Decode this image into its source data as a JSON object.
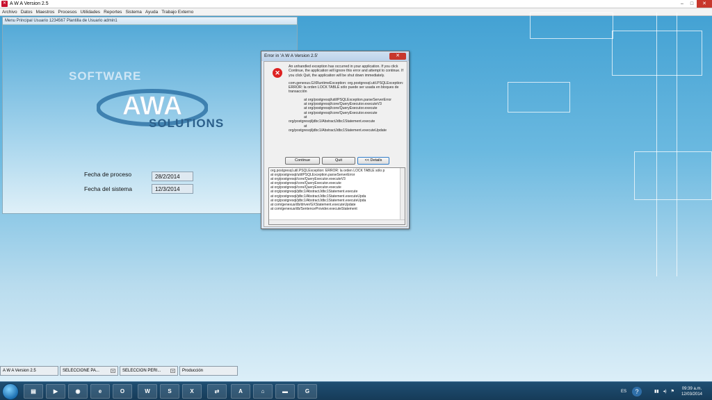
{
  "window": {
    "title": "A W A Version 2.5",
    "min": "–",
    "max": "□",
    "close": "✕"
  },
  "menu": [
    "Archivo",
    "Datos",
    "Maestros",
    "Procesos",
    "Utilidades",
    "Reportes",
    "Sistema",
    "Ayuda",
    "Trabajo Externo"
  ],
  "child_window": {
    "title": "Menu Principal  Usuario 1234567 Plantilla de Usuario admin1",
    "logo_software": "SOFTWARE",
    "logo_awa": "AWA",
    "logo_solutions": "SOLUTIONS",
    "fecha_proceso_label": "Fecha de proceso",
    "fecha_proceso_value": "28/2/2014",
    "fecha_sistema_label": "Fecha del sistema",
    "fecha_sistema_value": "12/3/2014"
  },
  "error_dialog": {
    "title": "Error in 'A W A Version 2.5'",
    "close": "✕",
    "icon": "error-icon",
    "message": "An unhandled exception has occurred in your application. If you click Continue, the application will ignore this error and attempt to continue. If you click Quit, the application will be shut down immediately.",
    "exception": "com.genexus.GXRuntimeException: org.postgresql.util.PSQLException: ERROR: la orden LOCK TABLE sólo puede ser usada en bloques de transacción",
    "stack": [
      "at org/postgresql/util/PSQLException.parseServerError",
      "at org/postgresql/core/QueryExecutor.executeV3",
      "at org/postgresql/core/QueryExecutor.execute",
      "at org/postgresql/core/QueryExecutor.execute",
      "at",
      "org/postgresql/jdbc1/AbstractJdbc1Statement.execute",
      "at",
      "org/postgresql/jdbc1/AbstractJdbc1Statement.executeUpdate"
    ],
    "btn_continue": "Continue",
    "btn_quit": "Quit",
    "btn_details": "<< Details",
    "details": [
      "org.postgresql.util.PSQLException: ERROR: la orden LOCK TABLE sólo p",
      "       at org/postgresql/util/PSQLException.parseServerError",
      "       at org/postgresql/core/QueryExecutor.executeV3",
      "       at org/postgresql/core/QueryExecutor.execute",
      "       at org/postgresql/core/QueryExecutor.execute",
      "       at org/postgresql/jdbc1/AbstractJdbc1Statement.execute",
      "       at org/postgresql/jdbc1/AbstractJdbc1Statement.executeUpda",
      "       at org/postgresql/jdbc1/AbstractJdbc1Statement.executeUpda",
      "       at com/genexus/db/driver/GXStatement.executeUpdate",
      "       at com/genexus/db/SentenceProvider.executeStatement"
    ]
  },
  "mdi_tabs": [
    "A W A Version 2.5",
    "SELECCIONE PA...",
    "SELECCION PERI...",
    "Producción"
  ],
  "taskbar": {
    "apps": [
      "folder-icon",
      "media-player-icon",
      "firefox-icon",
      "ie-icon",
      "outlook-icon",
      "word-icon",
      "skype-icon",
      "excel-icon",
      "teamviewer-icon",
      "acrobat-icon",
      "network-icon",
      "cmd-icon",
      "genexus-icon"
    ],
    "lang": "ES",
    "help": "?",
    "time": "09:39 a.m.",
    "date": "12/03/2014"
  }
}
